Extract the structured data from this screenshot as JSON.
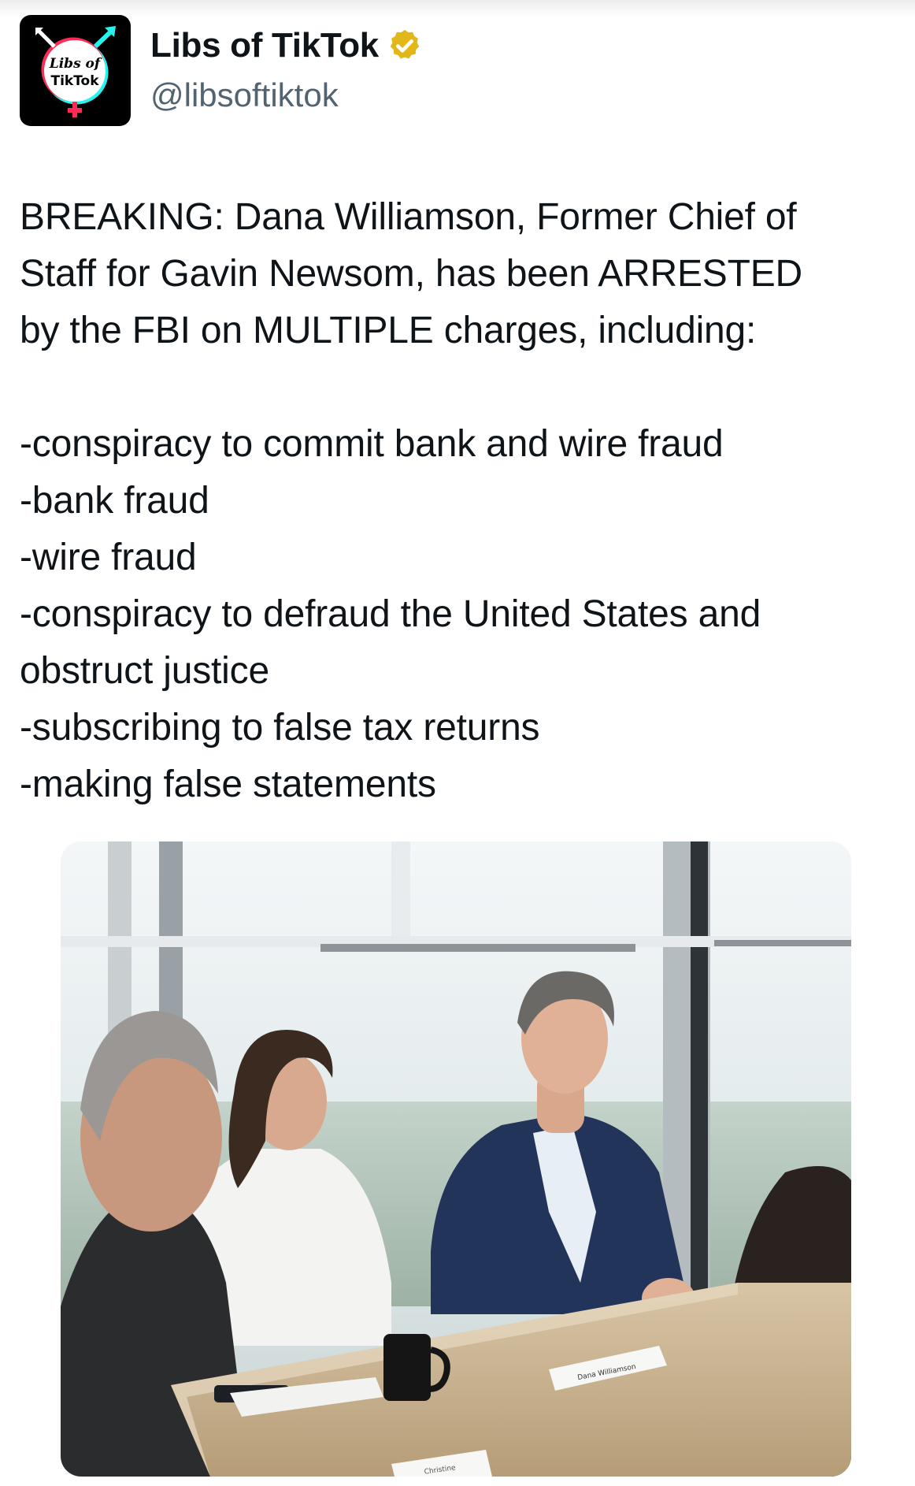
{
  "account": {
    "display_name": "Libs of TikTok",
    "handle": "@libsoftiktok",
    "verified": true,
    "avatar_logo_line1": "Libs of",
    "avatar_logo_line2": "TikTok",
    "icons": {
      "verified": "verified-badge-icon"
    },
    "colors": {
      "verified_gold": "#e2b719",
      "logo_cyan": "#25f4ee",
      "logo_pink": "#fe2c55"
    }
  },
  "tweet": {
    "lines": [
      "BREAKING: Dana Williamson, Former Chief of",
      "Staff for Gavin Newsom, has been ARRESTED",
      "by the FBI on MULTIPLE charges, including:",
      "",
      "-conspiracy to commit bank and wire fraud",
      "-bank fraud",
      "-wire fraud",
      "-conspiracy to defraud the United States and",
      "obstruct justice",
      "-subscribing to false tax returns",
      "-making false statements"
    ]
  },
  "media": {
    "placard_text": "Dana Williamson",
    "placard_text_2": "Christine"
  }
}
